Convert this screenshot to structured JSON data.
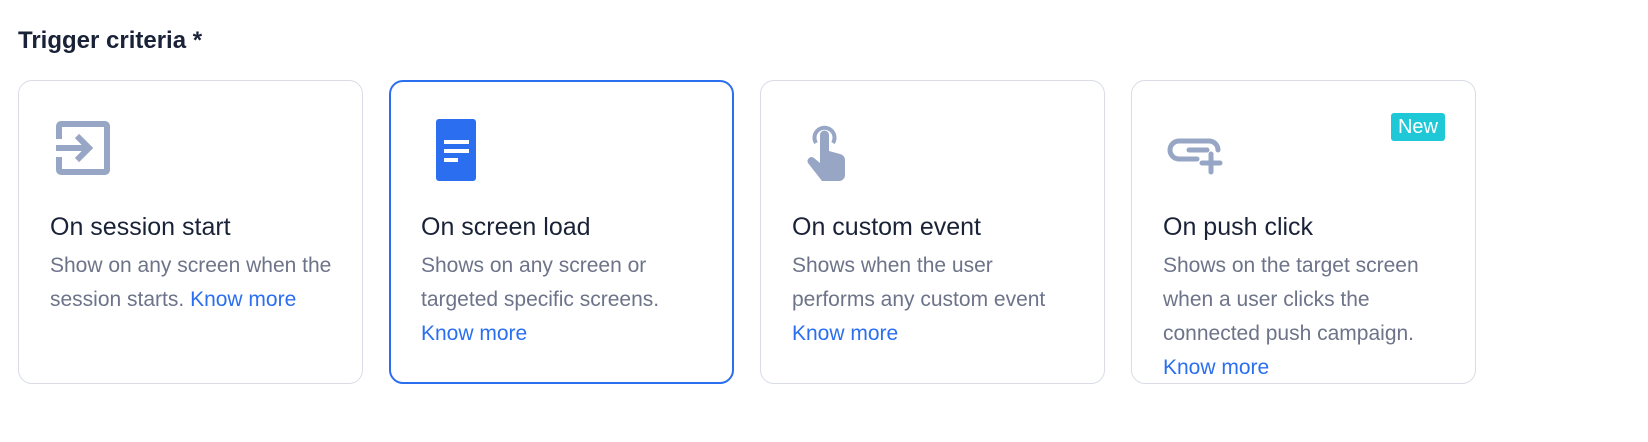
{
  "section": {
    "title": "Trigger criteria *"
  },
  "colors": {
    "accent": "#2b6ff0",
    "icon_gray": "#97a6c4",
    "badge": "#1fc8d6",
    "border": "#d9dce6",
    "title_text": "#1a2238",
    "desc_text": "#6d7489"
  },
  "cards": [
    {
      "title": "On session start",
      "desc": "Show on any screen when the session starts.",
      "link": "Know more",
      "icon": "session-enter-icon",
      "selected": false
    },
    {
      "title": "On screen load",
      "desc": "Shows on any screen or targeted specific screens.",
      "link": "Know more",
      "icon": "screen-document-icon",
      "selected": true
    },
    {
      "title": "On custom event",
      "desc": "Shows when the user performs any custom event",
      "link": "Know more",
      "icon": "tap-finger-icon",
      "selected": false
    },
    {
      "title": "On push click",
      "desc": "Shows on the target screen when a user clicks the connected push campaign.",
      "link": "Know more",
      "icon": "push-link-icon",
      "badge": "New",
      "selected": false
    }
  ]
}
